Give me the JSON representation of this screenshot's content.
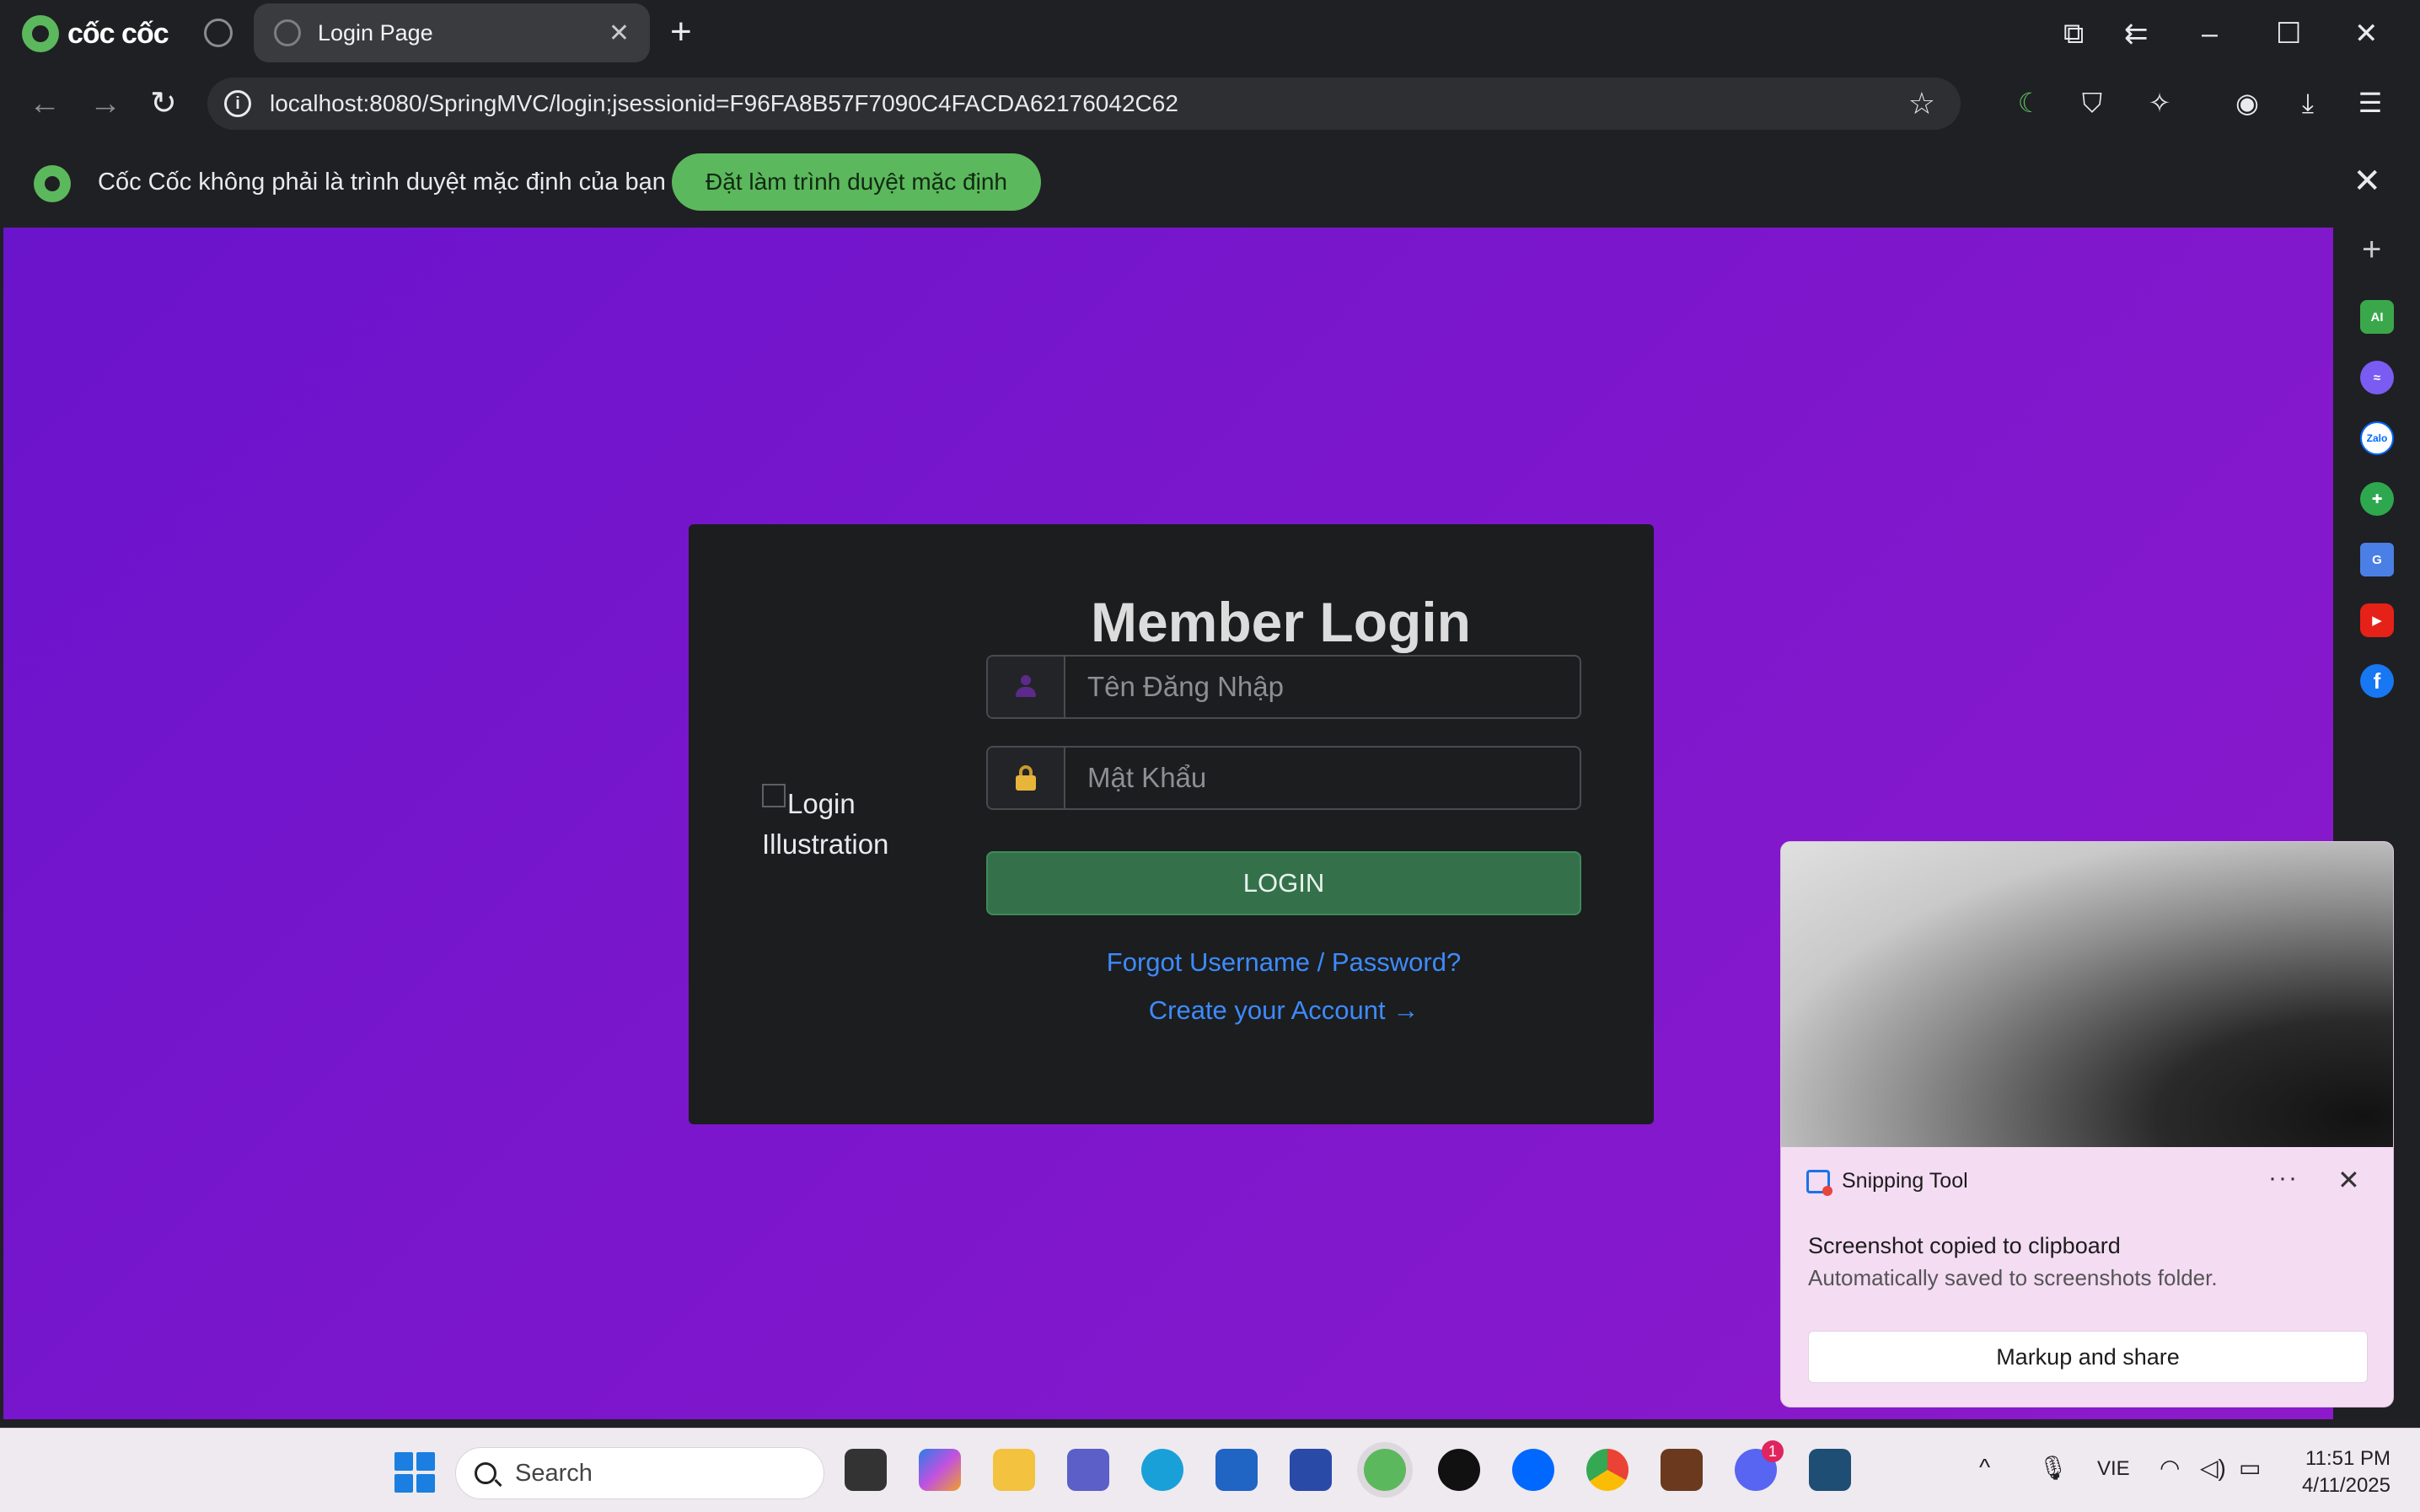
{
  "browser": {
    "brand": "cốc cốc",
    "tab_title": "Login Page",
    "url": "localhost:8080/SpringMVC/login;jsessionid=F96FA8B57F7090C4FACDA62176042C62"
  },
  "infobar": {
    "message": "Cốc Cốc không phải là trình duyệt mặc định của bạn",
    "button_label": "Đặt làm trình duyệt mặc định"
  },
  "login": {
    "title": "Member Login",
    "image_alt": "Login Illustration",
    "username_placeholder": "Tên Đăng Nhập",
    "password_placeholder": "Mật Khẩu",
    "button_label": "LOGIN",
    "forgot_link": "Forgot Username / Password?",
    "create_link": "Create your Account →"
  },
  "sidepanel": {
    "icons": [
      "ai-icon",
      "messenger-icon",
      "zalo-icon",
      "game-icon",
      "translate-icon",
      "youtube-icon",
      "facebook-icon"
    ],
    "labels": {
      "ai": "AI",
      "zalo": "Zalo"
    }
  },
  "toast": {
    "app_name": "Snipping Tool",
    "title": "Screenshot copied to clipboard",
    "subtitle": "Automatically saved to screenshots folder.",
    "button_label": "Markup and share",
    "more": "···"
  },
  "taskbar": {
    "search_label": "Search",
    "language": "VIE",
    "time": "11:51 PM",
    "date": "4/11/2025",
    "discord_badge": "1"
  },
  "colors": {
    "content_gradient_start": "#6a14cc",
    "content_gradient_end": "#8c1acb",
    "login_button": "#34714a",
    "link": "#3d8bfd",
    "coccoc_green": "#5cb85c"
  }
}
